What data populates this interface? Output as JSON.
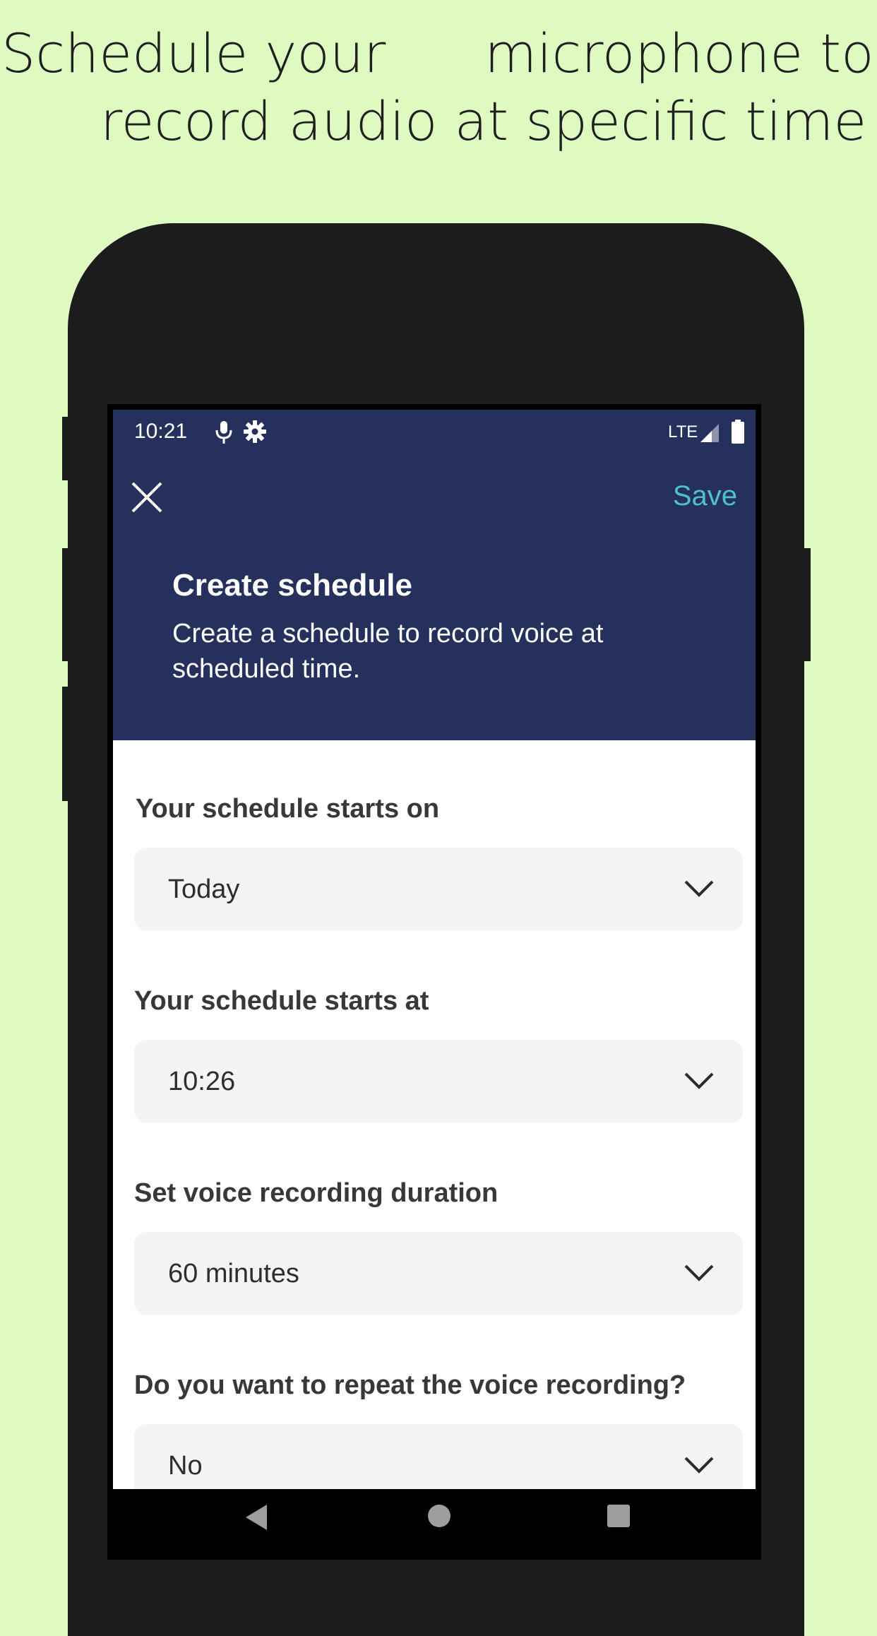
{
  "promo": {
    "line1_a": "Schedule your",
    "line1_b": "microphone to",
    "line2": "record audio at specific time"
  },
  "status_bar": {
    "time": "10:21",
    "network": "LTE",
    "icons": [
      "microphone-icon",
      "gear-icon",
      "signal-icon",
      "battery-icon"
    ]
  },
  "toolbar": {
    "close_icon": "close-icon",
    "save_label": "Save"
  },
  "header": {
    "title": "Create schedule",
    "subtitle": "Create a schedule to record voice at scheduled time."
  },
  "form": {
    "fields": [
      {
        "label": "Your schedule starts on",
        "value": "Today"
      },
      {
        "label": "Your schedule starts at",
        "value": "10:26"
      },
      {
        "label": "Set voice recording duration",
        "value": "60 minutes"
      },
      {
        "label": "Do you want to repeat the voice recording?",
        "value": "No"
      }
    ]
  },
  "colors": {
    "background": "#dffac0",
    "header": "#25305d",
    "accent": "#4dc2c6",
    "field_bg": "#f4f4f4"
  }
}
